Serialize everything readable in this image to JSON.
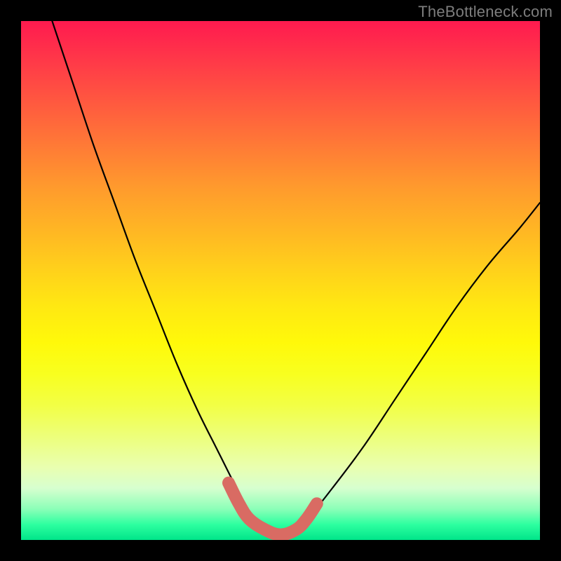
{
  "watermark": {
    "text": "TheBottleneck.com"
  },
  "colors": {
    "curve": "#000000",
    "bottom_accent": "#d96b63",
    "background_black": "#000000"
  },
  "chart_data": {
    "type": "line",
    "title": "",
    "xlabel": "",
    "ylabel": "",
    "xlim": [
      0,
      100
    ],
    "ylim": [
      0,
      100
    ],
    "grid": false,
    "legend": false,
    "series": [
      {
        "name": "bottleneck-curve",
        "description": "V-shaped curve; y≈0 indicates optimal match (green band), higher y indicates bottleneck (red)",
        "x": [
          6,
          10,
          14,
          18,
          22,
          26,
          30,
          34,
          38,
          42,
          44,
          47,
          50,
          53,
          56,
          60,
          66,
          72,
          78,
          84,
          90,
          96,
          100
        ],
        "y": [
          100,
          88,
          76,
          65,
          54,
          44,
          34,
          25,
          17,
          9,
          5,
          2,
          1,
          2,
          5,
          10,
          18,
          27,
          36,
          45,
          53,
          60,
          65
        ]
      },
      {
        "name": "optimal-region-highlight",
        "description": "Segment of curve in the green band near the minimum, drawn thick in salmon",
        "x": [
          40,
          42,
          44,
          47,
          50,
          53,
          55,
          57
        ],
        "y": [
          11,
          7,
          4,
          2,
          1,
          2,
          4,
          7
        ]
      }
    ]
  }
}
